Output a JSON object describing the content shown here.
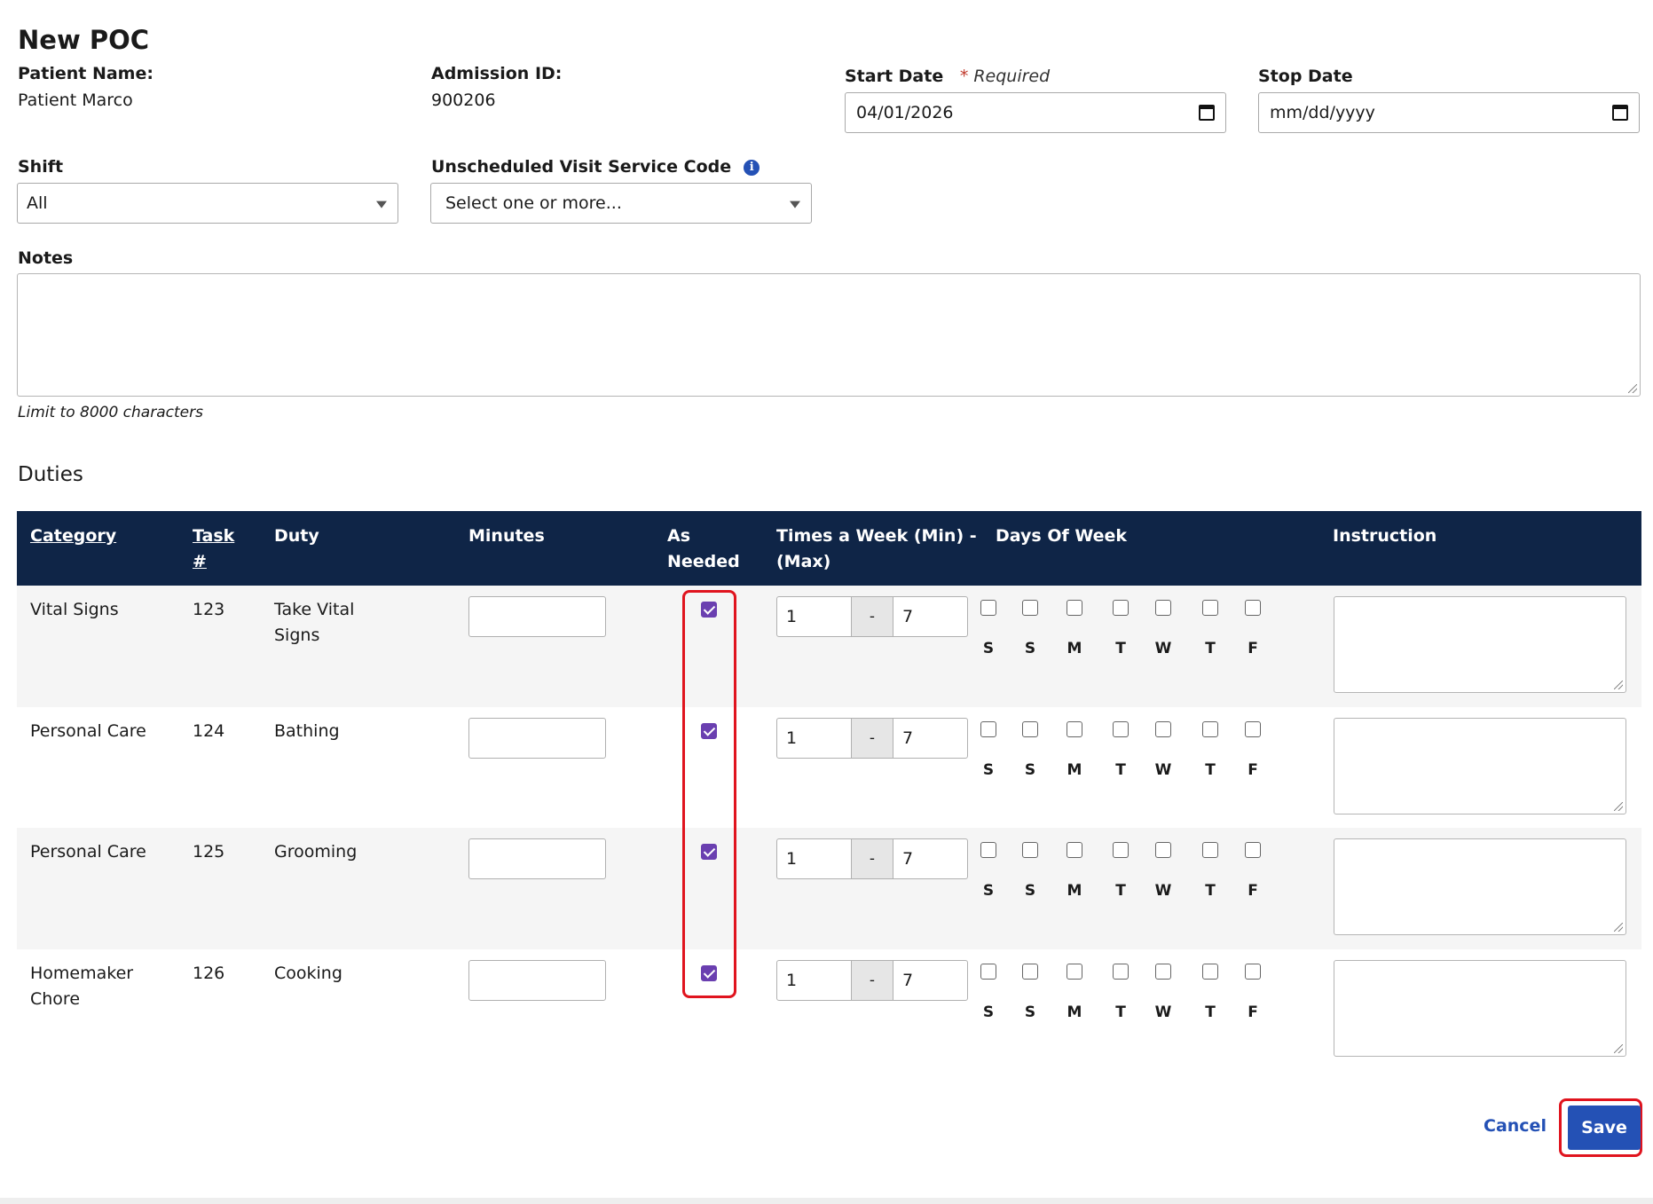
{
  "page_title": "New POC",
  "patient": {
    "label": "Patient Name:",
    "value": "Patient Marco"
  },
  "admission": {
    "label": "Admission ID:",
    "value": "900206"
  },
  "start_date": {
    "label": "Start Date",
    "required_star": "*",
    "required_text": "Required",
    "value": "04/01/2026"
  },
  "stop_date": {
    "label": "Stop Date",
    "placeholder": "mm/dd/yyyy"
  },
  "shift": {
    "label": "Shift",
    "value": "All"
  },
  "uvsc": {
    "label": "Unscheduled Visit Service Code",
    "info_glyph": "i",
    "placeholder": "Select one or more..."
  },
  "notes": {
    "label": "Notes",
    "hint": "Limit to 8000 characters"
  },
  "duties": {
    "title": "Duties",
    "headers": {
      "category": "Category",
      "task_line1": "Task",
      "task_line2": "#",
      "duty": "Duty",
      "minutes": "Minutes",
      "as_needed_line1": "As",
      "as_needed_line2": "Needed",
      "times_line1": "Times a Week (Min) -",
      "times_line2": "(Max)",
      "days": "Days Of Week",
      "instruction": "Instruction"
    },
    "day_labels": [
      "S",
      "S",
      "M",
      "T",
      "W",
      "T",
      "F"
    ],
    "range_separator": "-",
    "rows": [
      {
        "category_line1": "Vital Signs",
        "category_line2": "",
        "task": "123",
        "duty_line1": "Take Vital",
        "duty_line2": "Signs",
        "as_needed": true,
        "min": "1",
        "max": "7"
      },
      {
        "category_line1": "Personal Care",
        "category_line2": "",
        "task": "124",
        "duty_line1": "Bathing",
        "duty_line2": "",
        "as_needed": true,
        "min": "1",
        "max": "7"
      },
      {
        "category_line1": "Personal Care",
        "category_line2": "",
        "task": "125",
        "duty_line1": "Grooming",
        "duty_line2": "",
        "as_needed": true,
        "min": "1",
        "max": "7"
      },
      {
        "category_line1": "Homemaker",
        "category_line2": "Chore",
        "task": "126",
        "duty_line1": "Cooking",
        "duty_line2": "",
        "as_needed": true,
        "min": "1",
        "max": "7"
      }
    ]
  },
  "actions": {
    "cancel": "Cancel",
    "save": "Save"
  },
  "colors": {
    "header_bg": "#0f2547",
    "primary": "#2451b5",
    "checkbox": "#6a3fb0",
    "highlight": "#e0141e"
  }
}
